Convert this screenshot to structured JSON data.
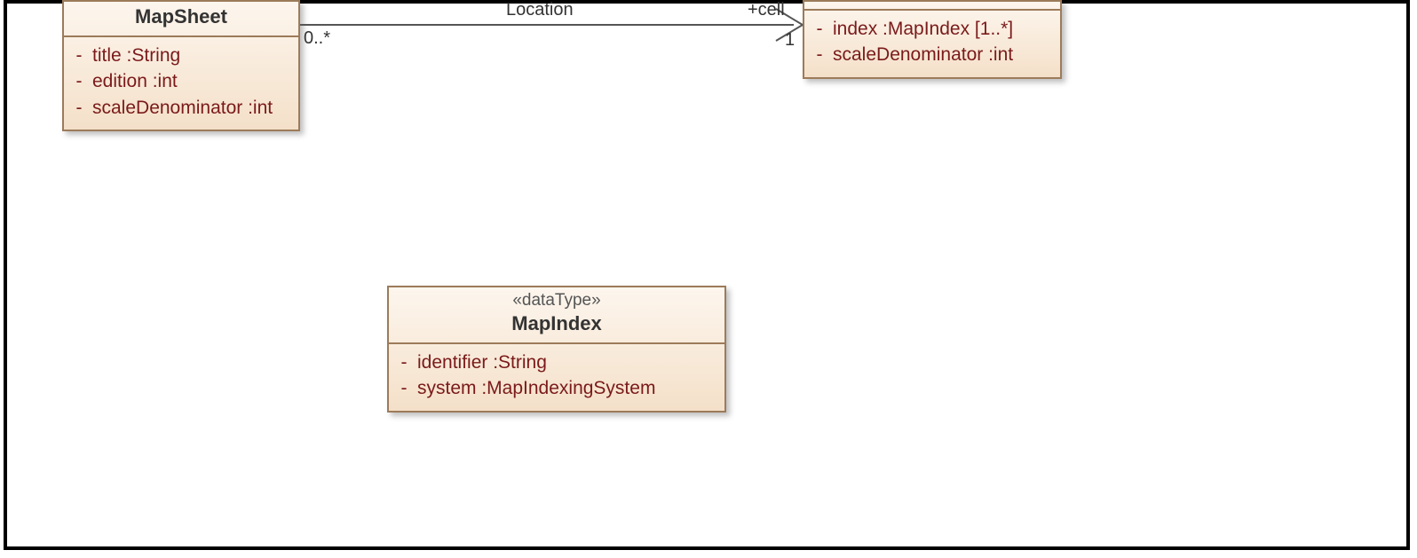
{
  "classes": {
    "mapSheet": {
      "name": "MapSheet",
      "attributes": [
        {
          "vis": "-",
          "text": "title  :String"
        },
        {
          "vis": "-",
          "text": "edition  :int"
        },
        {
          "vis": "-",
          "text": "scaleDenominator  :int"
        }
      ]
    },
    "right": {
      "name": "",
      "attributes": [
        {
          "vis": "-",
          "text": "index  :MapIndex [1..*]"
        },
        {
          "vis": "-",
          "text": "scaleDenominator  :int"
        }
      ]
    },
    "mapIndex": {
      "stereotype": "«dataType»",
      "name": "MapIndex",
      "attributes": [
        {
          "vis": "-",
          "text": "identifier  :String"
        },
        {
          "vis": "-",
          "text": "system  :MapIndexingSystem"
        }
      ]
    }
  },
  "association": {
    "name": "Location",
    "role": "+cell",
    "multLeft": "0..*",
    "multRight": "1"
  }
}
